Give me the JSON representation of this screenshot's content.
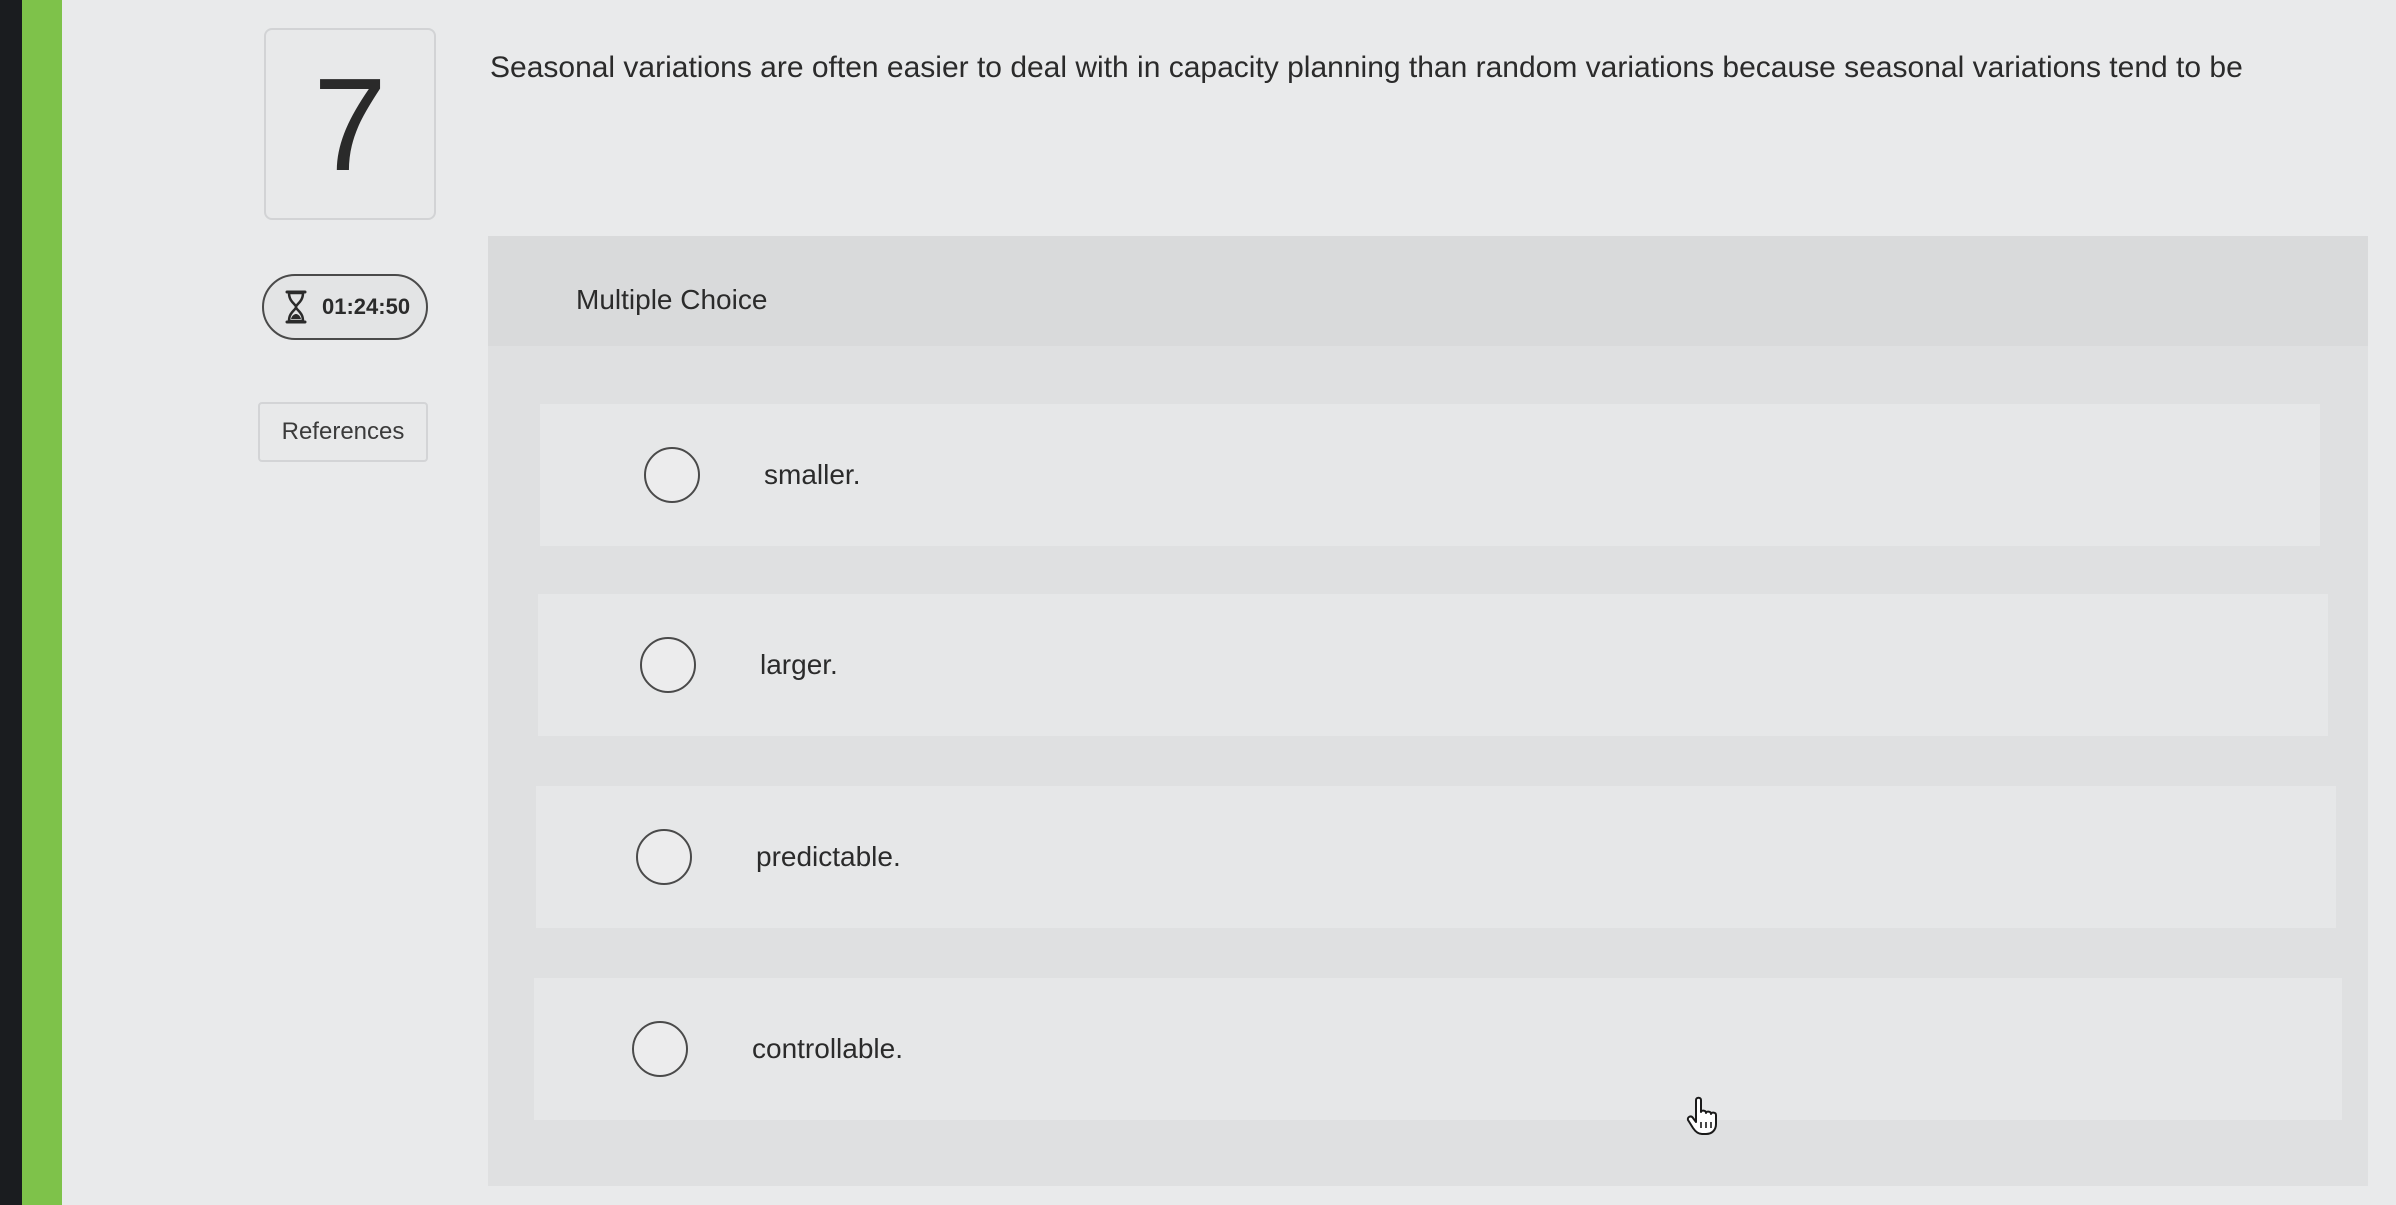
{
  "question": {
    "number": "7",
    "text": "Seasonal variations are often easier to deal with in capacity planning than random variations because seasonal variations tend to be"
  },
  "timer": {
    "icon": "hourglass-icon",
    "value": "01:24:50"
  },
  "references": {
    "label": "References"
  },
  "multiple_choice": {
    "header": "Multiple Choice",
    "options": [
      {
        "label": "smaller.",
        "selected": false
      },
      {
        "label": "larger.",
        "selected": false
      },
      {
        "label": "predictable.",
        "selected": false
      },
      {
        "label": "controllable.",
        "selected": false
      }
    ]
  },
  "colors": {
    "accent_green": "#7ec24a",
    "page_background": "#e9eaeb",
    "text": "#2b2b2b"
  }
}
